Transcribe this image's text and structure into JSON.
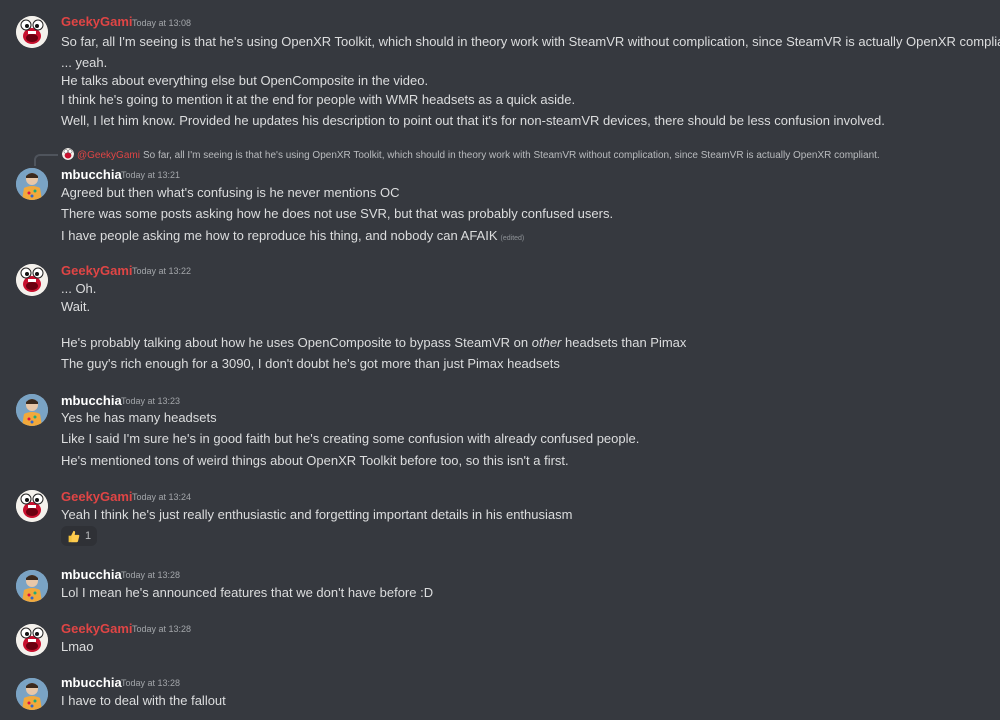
{
  "messages": [
    {
      "author": "GeekyGami",
      "timestamp": "Today at 13:08",
      "lines": [
        "So far, all I'm seeing is that he's using OpenXR Toolkit, which should in theory work with SteamVR without complication, since SteamVR is actually OpenXR compliant.",
        "... yeah.",
        "He talks about everything else but OpenComposite in the video.",
        "I think he's going to mention it at the end for people with WMR headsets as a quick aside.",
        "Well, I let him know. Provided he updates his description to point out that it's for non-steamVR devices, there should be less confusion involved."
      ]
    },
    {
      "reply_to": {
        "author": "@GeekyGami",
        "text": "So far, all I'm seeing is that he's using OpenXR Toolkit, which should in theory work with SteamVR without complication, since SteamVR is actually OpenXR compliant."
      },
      "author": "mbucchia",
      "timestamp": "Today at 13:21",
      "lines": [
        "Agreed but then what's confusing is he never mentions OC",
        "There was some posts asking how he does not use SVR, but that was probably confused users.",
        "I have people asking me how to reproduce his thing, and nobody can AFAIK"
      ],
      "edited_label": "(edited)"
    },
    {
      "author": "GeekyGami",
      "timestamp": "Today at 13:22",
      "lines": [
        "... Oh.",
        "Wait.",
        "He's probably talking about how he uses OpenComposite to bypass SteamVR on ",
        "The guy's rich enough for a 3090, I don't doubt he's got more than just Pimax headsets"
      ],
      "emphasis_word": "other",
      "line_suffix": " headsets than Pimax"
    },
    {
      "author": "mbucchia",
      "timestamp": "Today at 13:23",
      "lines": [
        "Yes he has many headsets",
        "Like I said I'm sure he's in good faith but he's creating some confusion with already confused people.",
        "He's mentioned tons of weird things about OpenXR Toolkit before too, so this isn't a first."
      ]
    },
    {
      "author": "GeekyGami",
      "timestamp": "Today at 13:24",
      "lines": [
        "Yeah I think he's just really enthusiastic and forgetting important details in his enthusiasm"
      ],
      "reaction": {
        "emoji": "thumbs-up-icon",
        "count": "1"
      }
    },
    {
      "author": "mbucchia",
      "timestamp": "Today at 13:28",
      "lines": [
        "Lol I mean he's announced features that we don't have before :D"
      ]
    },
    {
      "author": "GeekyGami",
      "timestamp": "Today at 13:28",
      "lines": [
        "Lmao"
      ]
    },
    {
      "author": "mbucchia",
      "timestamp": "Today at 13:28",
      "lines": [
        "I have to deal with the fallout"
      ]
    }
  ],
  "colors": {
    "background": "#36393f",
    "geekygami_name": "#e04545",
    "mbucchia_name": "#ffffff",
    "text": "#dcddde",
    "timestamp": "#a3a6aa"
  }
}
